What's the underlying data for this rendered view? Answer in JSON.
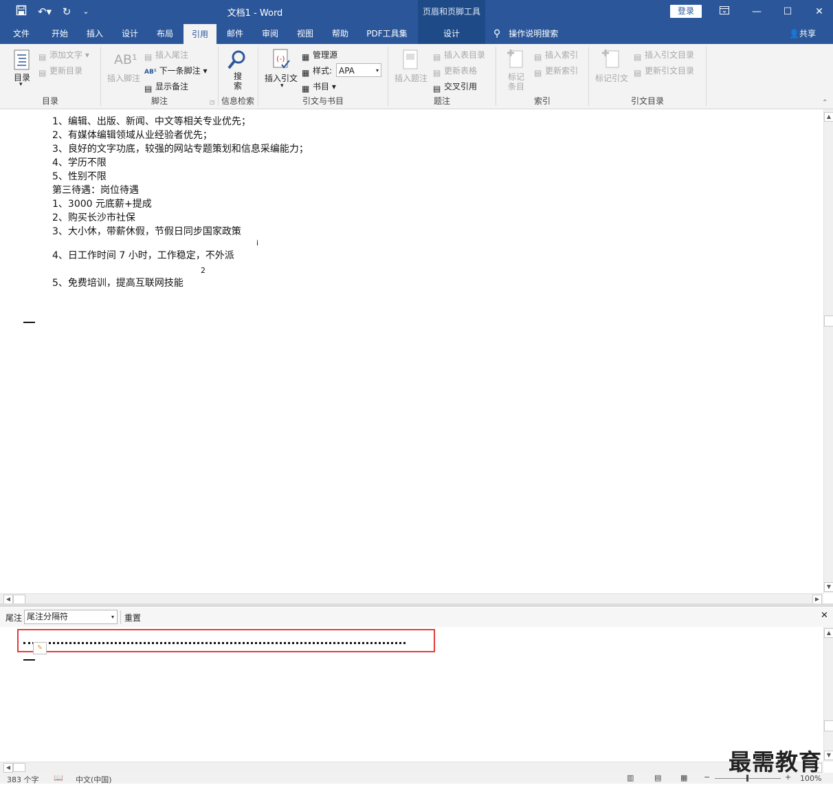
{
  "titlebar": {
    "doc_title": "文档1  -  Word",
    "context_tools": "页眉和页脚工具",
    "login": "登录"
  },
  "tabs": [
    {
      "label": "文件"
    },
    {
      "label": "开始"
    },
    {
      "label": "插入"
    },
    {
      "label": "设计"
    },
    {
      "label": "布局"
    },
    {
      "label": "引用"
    },
    {
      "label": "邮件"
    },
    {
      "label": "审阅"
    },
    {
      "label": "视图"
    },
    {
      "label": "帮助"
    },
    {
      "label": "PDF工具集"
    },
    {
      "label": "设计"
    }
  ],
  "tell_me": "操作说明搜索",
  "share": "共享",
  "ribbon": {
    "toc": {
      "big": "目录",
      "add_text": "添加文字",
      "update_toc": "更新目录",
      "label": "目录"
    },
    "footnote": {
      "insert_footnote": "插入脚注",
      "insert_endnote": "插入尾注",
      "next_footnote": "下一条脚注",
      "show_notes": "显示备注",
      "label": "脚注"
    },
    "research": {
      "search": "搜\n索",
      "label": "信息检索"
    },
    "citations": {
      "insert_citation": "插入引文",
      "manage_sources": "管理源",
      "style_label": "样式:",
      "style_value": "APA",
      "bibliography": "书目",
      "label": "引文与书目"
    },
    "captions": {
      "insert_caption": "插入题注",
      "insert_table_of_figures": "插入表目录",
      "update_table": "更新表格",
      "cross_reference": "交叉引用",
      "label": "题注"
    },
    "index": {
      "mark_entry": "标记\n条目",
      "insert_index": "插入索引",
      "update_index": "更新索引",
      "label": "索引"
    },
    "toa": {
      "mark_citation": "标记引文",
      "insert_toa": "插入引文目录",
      "update_toa": "更新引文目录",
      "label": "引文目录"
    }
  },
  "document": {
    "lines": [
      "1、编辑、出版、新闻、中文等相关专业优先；",
      "2、有媒体编辑领域从业经验者优先；",
      "3、良好的文字功底，较强的网站专题策划和信息采编能力；",
      "4、学历不限",
      "5、性别不限",
      "第三待遇：岗位待遇",
      "1、3000 元底薪+提成",
      "2、购买长沙市社保",
      "3、大小休，带薪休假，节假日同步国家政策",
      "4、日工作时间 7 小时，工作稳定，不外派",
      "5、免费培训，提高互联网技能"
    ],
    "sup_1": "i",
    "sup_2": "2"
  },
  "endnote_pane": {
    "label": "尾注",
    "select_value": "尾注分隔符",
    "reset": "重置"
  },
  "status": {
    "word_count": "383 个字",
    "language": "中文(中国)",
    "zoom": "100%"
  },
  "watermark": "最需教育",
  "colors": {
    "brand": "#2b579a",
    "highlight": "#e43a3a"
  }
}
